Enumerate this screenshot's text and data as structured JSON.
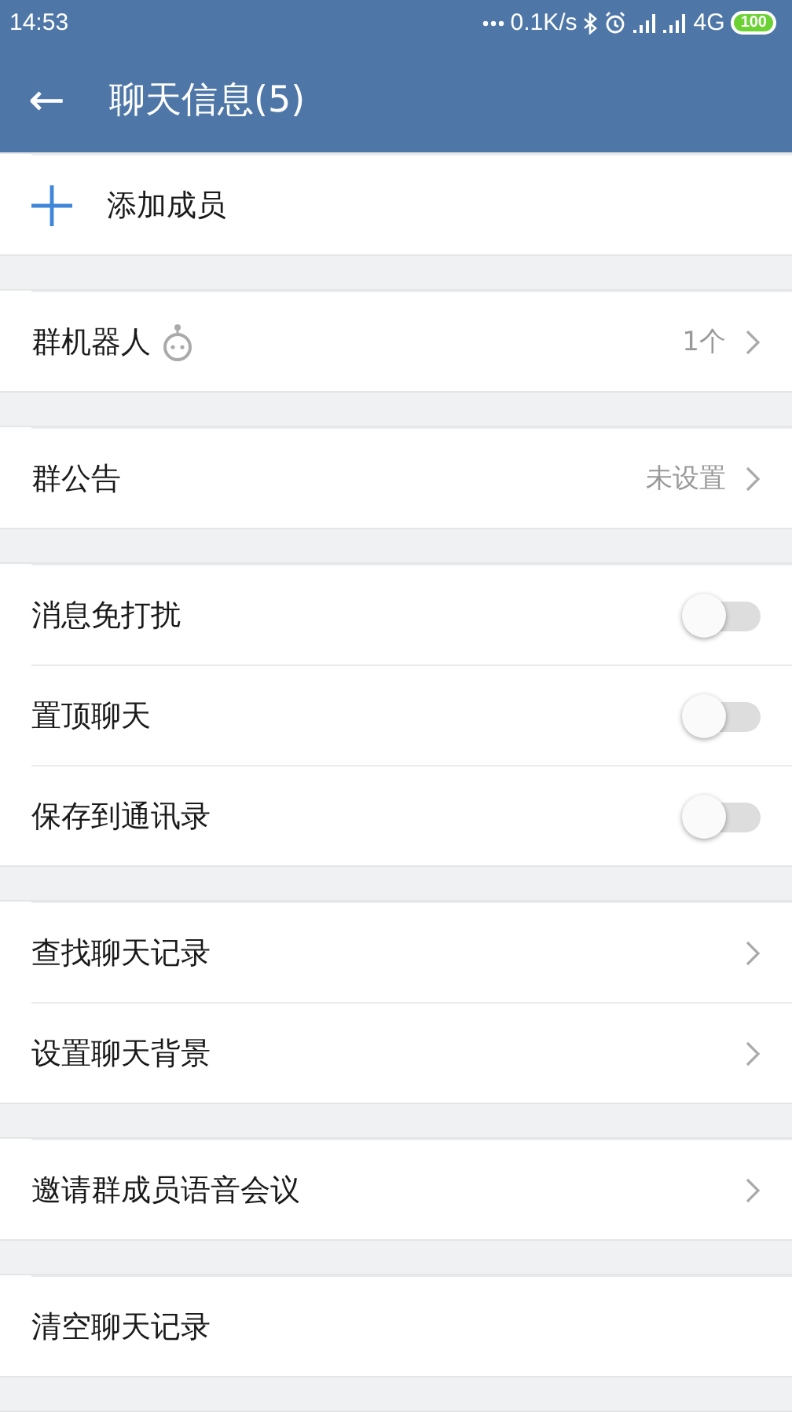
{
  "status_bar": {
    "time": "14:53",
    "speed": "0.1K/s",
    "network": "4G",
    "battery": "100"
  },
  "header": {
    "back": "←",
    "title": "聊天信息(5)"
  },
  "groups": [
    {
      "rows": [
        {
          "kind": "add",
          "label": "添加成员"
        }
      ]
    },
    {
      "rows": [
        {
          "kind": "value",
          "label": "群机器人",
          "robot": true,
          "value": "1个"
        }
      ]
    },
    {
      "rows": [
        {
          "kind": "value",
          "label": "群公告",
          "value": "未设置"
        }
      ]
    },
    {
      "rows": [
        {
          "kind": "toggle",
          "label": "消息免打扰",
          "on": false
        },
        {
          "kind": "toggle",
          "label": "置顶聊天",
          "on": false
        },
        {
          "kind": "toggle",
          "label": "保存到通讯录",
          "on": false
        }
      ]
    },
    {
      "rows": [
        {
          "kind": "link",
          "label": "查找聊天记录"
        },
        {
          "kind": "link",
          "label": "设置聊天背景"
        }
      ]
    },
    {
      "rows": [
        {
          "kind": "link",
          "label": "邀请群成员语音会议"
        }
      ]
    },
    {
      "rows": [
        {
          "kind": "plain",
          "label": "清空聊天记录"
        }
      ]
    }
  ]
}
